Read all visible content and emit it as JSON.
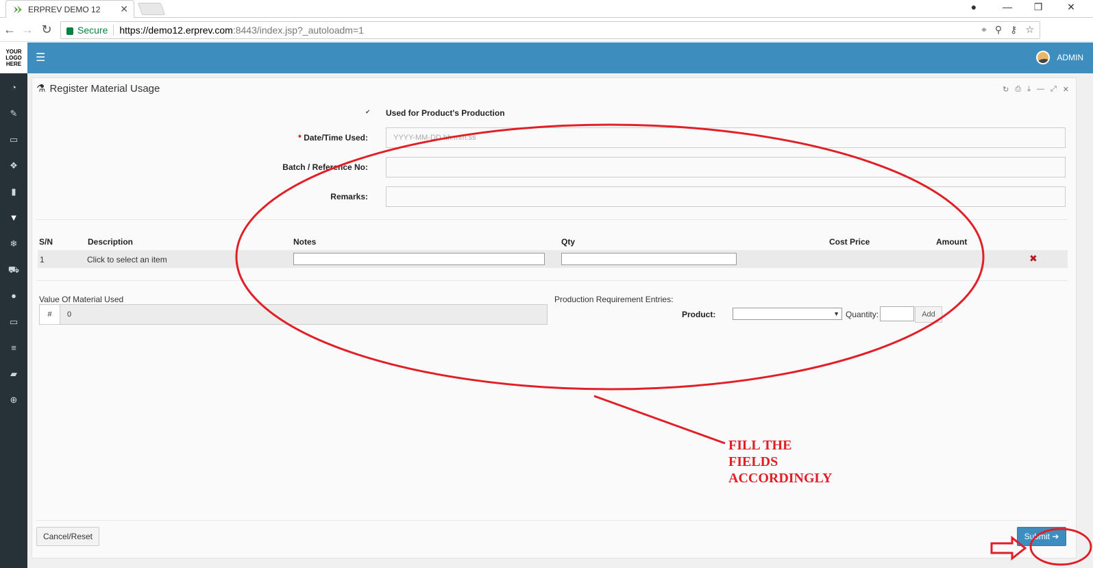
{
  "browser": {
    "tab_title": "ERPREV DEMO 12",
    "tab_close": "✕",
    "secure_label": "Secure",
    "url_scheme_host": "https://demo12.erprev.com",
    "url_rest": ":8443/index.jsp?_autoloadm=1"
  },
  "header": {
    "logo_lines": [
      "YOUR",
      "LOGO",
      "HERE"
    ],
    "user_name": "ADMIN",
    "accent_color": "#3d8ebf"
  },
  "sidebar": {
    "icons": [
      "dashboard-icon",
      "tag-icon",
      "money-icon",
      "cubes-icon",
      "building-icon",
      "flask-icon",
      "snowflake-icon",
      "cart-icon",
      "circle-icon",
      "monitor-icon",
      "database-icon",
      "book-icon",
      "lifebuoy-icon"
    ]
  },
  "panel": {
    "title": "Register Material Usage",
    "tools": [
      "refresh-icon",
      "print-icon",
      "download-icon",
      "minimize-icon",
      "expand-icon",
      "close-icon"
    ]
  },
  "form": {
    "used_for_production_label": "Used for Product's Production",
    "used_for_production_checked": true,
    "date_required_mark": "*",
    "date_label": "Date/Time Used:",
    "date_placeholder": "YYYY-MM-DD hh:mm:ss",
    "batch_label": "Batch / Reference No:",
    "remarks_label": "Remarks:"
  },
  "table": {
    "headers": [
      "S/N",
      "Description",
      "Notes",
      "Qty",
      "Cost Price",
      "Amount"
    ],
    "rows": [
      {
        "sn": "1",
        "description": "Click to select an item"
      }
    ]
  },
  "summary": {
    "value_label": "Value Of Material Used",
    "value_prefix": "#",
    "value": "0",
    "production_label": "Production Requirement Entries:",
    "product_label": "Product:",
    "product_selected": "",
    "quantity_label": "Quantity:",
    "add_label": "Add"
  },
  "footer": {
    "cancel_label": "Cancel/Reset",
    "submit_label": "Submit"
  },
  "annotation": {
    "lines": [
      "FILL THE",
      "FIELDS",
      "ACCORDINGLY"
    ],
    "color": "#e01f26"
  }
}
